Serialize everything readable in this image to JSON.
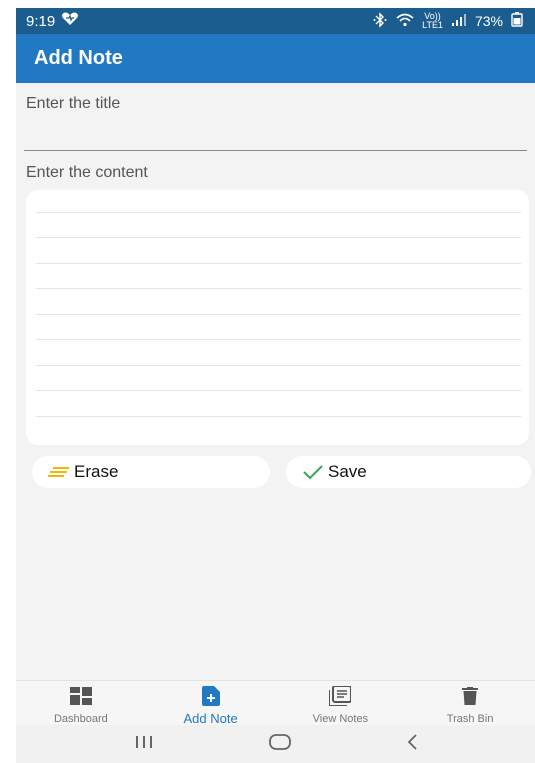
{
  "status_bar": {
    "time": "9:19",
    "volte_top": "Vo))",
    "volte_bottom": "LTE1",
    "battery": "73%"
  },
  "app_bar": {
    "title": "Add Note"
  },
  "form": {
    "title_placeholder": "Enter the title",
    "content_label": "Enter the content"
  },
  "actions": {
    "erase_label": "Erase",
    "save_label": "Save"
  },
  "bottom_nav": {
    "items": [
      {
        "label": "Dashboard",
        "icon": "dashboard-icon"
      },
      {
        "label": "Add Note",
        "icon": "add-note-icon",
        "active": true
      },
      {
        "label": "View Notes",
        "icon": "view-notes-icon"
      },
      {
        "label": "Trash Bin",
        "icon": "trash-icon"
      }
    ]
  },
  "colors": {
    "status_bar": "#1b5d8f",
    "app_bar": "#2179c4",
    "accent": "#2179c4",
    "erase_icon": "#f2b705",
    "save_icon": "#3aa655"
  }
}
